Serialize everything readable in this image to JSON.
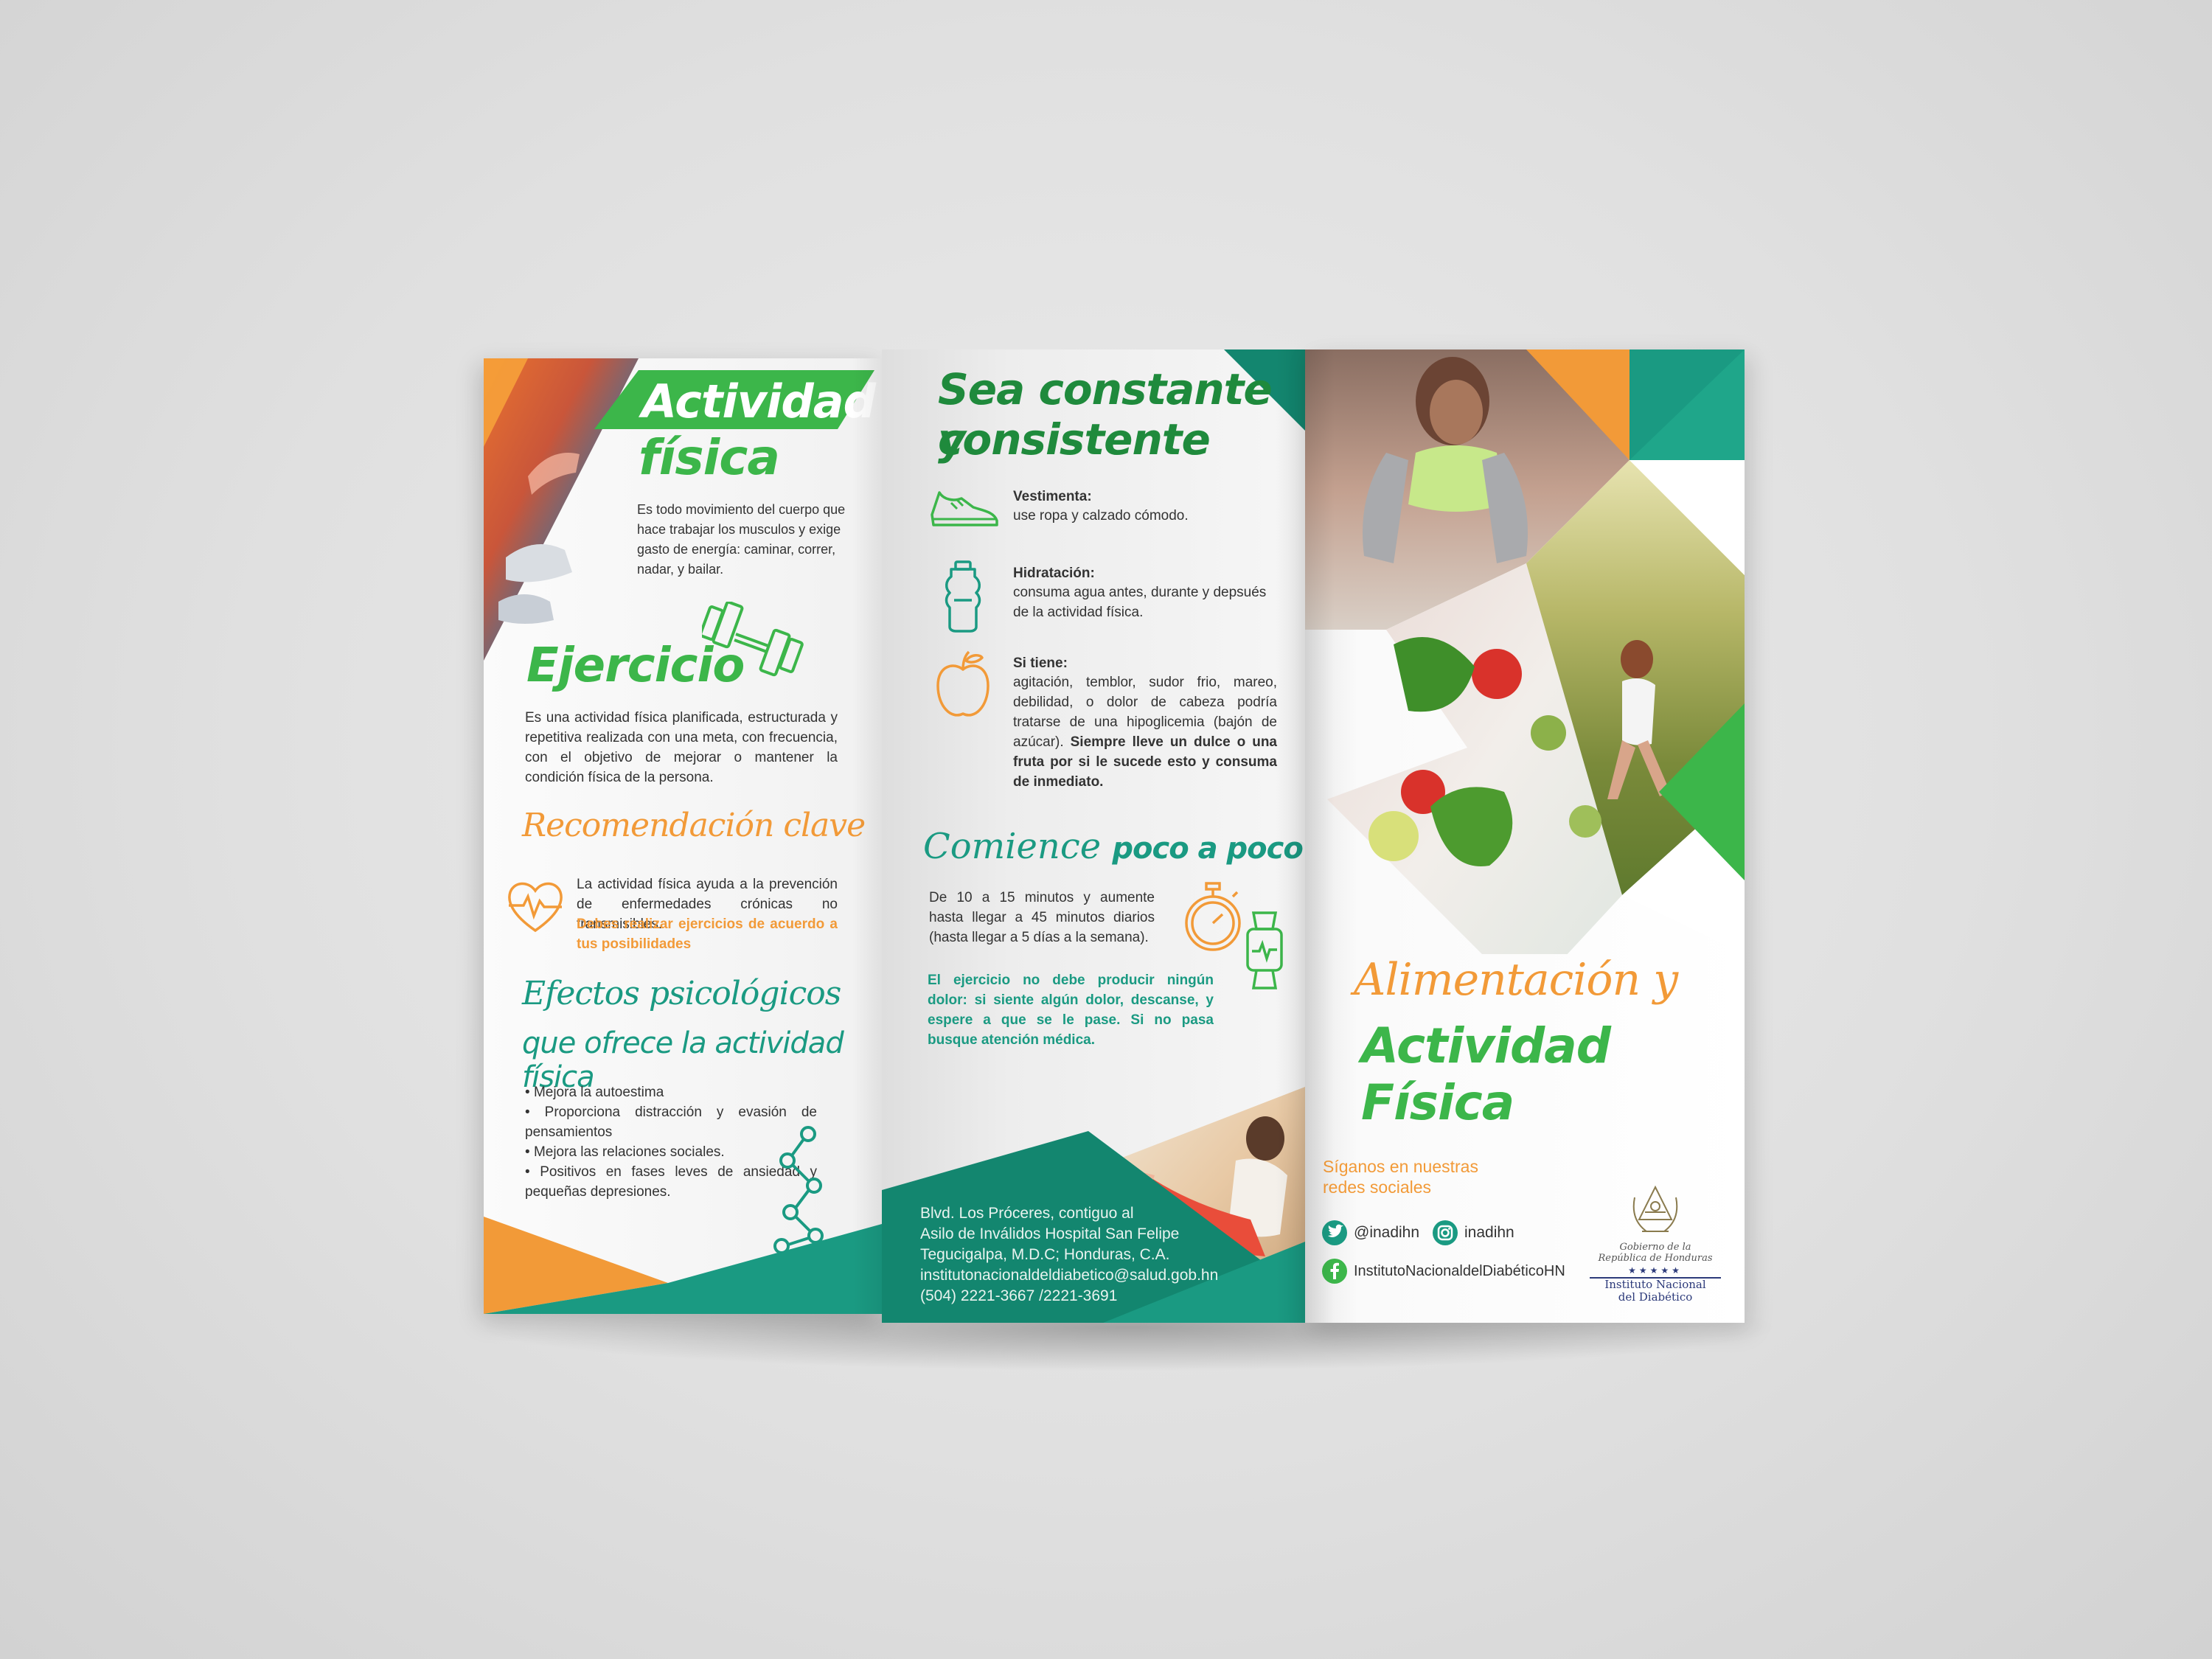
{
  "panel1": {
    "title_line1": "Actividad",
    "title_line2": "física",
    "intro": "Es todo movimiento del cuerpo que hace trabajar los musculos y exige gasto de energía: caminar, correr, nadar, y bailar.",
    "exercise_title": "Ejercicio",
    "exercise_text": "Es una actividad física planificada, estructurada y repetitiva realizada con una meta, con frecuencia, con el objetivo de mejorar o mantener la condición física de la persona.",
    "rec_title": "Recomendación clave",
    "rec_text": "La actividad física ayuda a la prevención de enfermedades crónicas no transmisibles.",
    "rec_highlight": "Debes realizar ejercicios de acuerdo a tus posibilidades",
    "psych_title_line1": "Efectos psicológicos",
    "psych_title_line2": "que ofrece la actividad física",
    "psych_items": [
      "Mejora la autoestima",
      "Proporciona distracción y evasión de pensamientos",
      "Mejora las relaciones sociales.",
      "Positivos en fases leves de ansiedad y pequeñas depresiones."
    ]
  },
  "panel2": {
    "title_line1": "Sea constante y",
    "title_line2": "consistente",
    "tips": [
      {
        "label": "Vestimenta:",
        "text": "use ropa y calzado cómodo.",
        "icon": "shoe-icon"
      },
      {
        "label": "Hidratación:",
        "text": "consuma agua antes, durante y depsués de la actividad física.",
        "icon": "water-bottle-icon"
      },
      {
        "label": "Si tiene:",
        "text": "agitación, temblor, sudor frio, mareo, debilidad, o dolor de cabeza podría tratarse de una hipoglicemia (bajón de azúcar).",
        "bold": "Siempre lleve un dulce o una fruta por si le sucede esto y consuma de inmediato.",
        "icon": "apple-icon"
      }
    ],
    "start_title_a": "Comience",
    "start_title_b": "poco a poco",
    "start_text": "De 10 a 15 minutos y aumente hasta llegar a 45 minutos diarios (hasta llegar a 5 días a la semana).",
    "warning": "El ejercicio no debe producir ningún dolor: si siente algún dolor, descanse, y espere a que se le pase. Si no pasa busque atención médica.",
    "address": [
      "Blvd. Los Próceres, contiguo al",
      "Asilo de Inválidos Hospital San Felipe",
      "Tegucigalpa, M.D.C; Honduras, C.A.",
      "institutonacionaldeldiabetico@salud.gob.hn",
      "(504) 2221-3667 /2221-3691"
    ]
  },
  "panel3": {
    "title_line1": "Alimentación y",
    "title_line2": "Actividad Física",
    "follow_line1": "Síganos en nuestras",
    "follow_line2": "redes sociales",
    "twitter": "@inadihn",
    "instagram": "inadihn",
    "facebook": "InstitutoNacionaldelDiabéticoHN",
    "logo_gov_line1": "Gobierno de la",
    "logo_gov_line2": "República de Honduras",
    "logo_inst_line1": "Instituto Nacional",
    "logo_inst_line2": "del Diabético"
  },
  "colors": {
    "green": "#3cb64a",
    "orange": "#f29a38",
    "teal": "#1a9a82",
    "dark_teal": "#13866f"
  }
}
